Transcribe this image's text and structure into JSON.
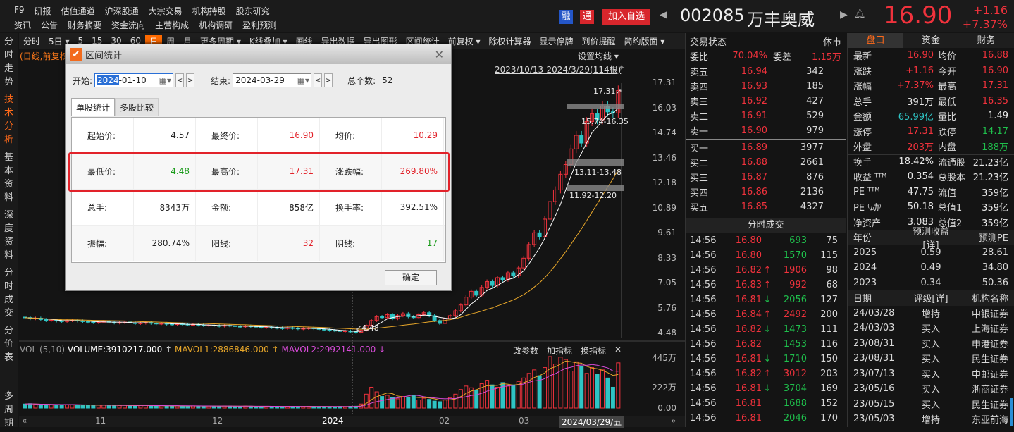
{
  "top_menu": {
    "row1": [
      "F9",
      "研报",
      "估值通道",
      "沪深股通",
      "大宗交易",
      "机构持股",
      "股东研究"
    ],
    "row2": [
      "资讯",
      "公告",
      "财务摘要",
      "资金流向",
      "主营构成",
      "机构调研",
      "盈利预测"
    ]
  },
  "header": {
    "badge_rong": "融",
    "badge_tong": "通",
    "add_watchlist": "加入自选",
    "code": "002085",
    "name": "万丰奥威",
    "price": "16.90",
    "change": "+1.16",
    "change_pct": "+7.37%"
  },
  "sidebar": [
    "分时走势",
    "技术分析",
    "基本资料",
    "深度资料",
    "分时成交",
    "分价表",
    "多周期"
  ],
  "toolbar": [
    "分时",
    "5日 ▾",
    "5",
    "15",
    "30",
    "60",
    "日",
    "周",
    "月",
    "更多周期 ▾",
    "K线叠加 ▾",
    "画线",
    "导出数据",
    "导出图形",
    "区间统计",
    "前复权 ▾",
    "除权计算器",
    "显示停牌",
    "到价提醒",
    "简约版面 ▾"
  ],
  "chart": {
    "mode_label": "(日线,前复权)",
    "ma_setting": "设置均线 ▾",
    "range_label": "2023/10/13-2024/3/29(114根)",
    "high_label": "17.31↗",
    "low_label": "↙4.48",
    "zone1": "15.74-16.35",
    "zone2": "13.11-13.48",
    "zone3": "11.92-12.20",
    "price_ticks": [
      "17.31",
      "16.03",
      "14.74",
      "13.46",
      "12.18",
      "10.89",
      "9.61",
      "8.33",
      "7.05",
      "5.76",
      "4.48"
    ],
    "vol_legend": {
      "vol": "VOL (5,10)",
      "volume": "VOLUME:3910217.000 ↑",
      "mavol1": "MAVOL1:2886846.000 ↑",
      "mavol2": "MAVOL2:2992141.000 ↓"
    },
    "vol_actions": [
      "改参数",
      "加指标",
      "换指标",
      "✕"
    ],
    "vol_ticks": [
      "445万",
      "222万",
      "0.00"
    ],
    "date_ticks": [
      "11",
      "12",
      "2024",
      "02",
      "03"
    ],
    "cursor_date": "2024/03/29/五"
  },
  "chart_data": {
    "type": "candlestick",
    "range": "2023/10/13-2024/3/29",
    "ylim": [
      4.48,
      17.31
    ],
    "closes": [
      5.25,
      5.2,
      5.22,
      5.15,
      5.1,
      5.12,
      5.08,
      5.05,
      5.1,
      5.12,
      5.08,
      5.05,
      5.02,
      5.0,
      5.03,
      5.05,
      5.02,
      4.98,
      5.0,
      5.02,
      4.98,
      4.95,
      4.97,
      5.0,
      4.96,
      4.94,
      4.95,
      4.92,
      4.9,
      4.93,
      4.91,
      4.88,
      4.9,
      4.87,
      4.85,
      4.86,
      4.84,
      4.82,
      4.85,
      4.83,
      4.8,
      4.78,
      4.82,
      4.8,
      4.78,
      4.75,
      4.77,
      4.74,
      4.72,
      4.7,
      4.73,
      4.71,
      4.68,
      4.7,
      4.72,
      4.69,
      4.65,
      4.62,
      4.6,
      4.58,
      4.55,
      4.57,
      4.52,
      4.5,
      4.6,
      4.85,
      5.1,
      5.3,
      5.25,
      5.4,
      5.2,
      5.35,
      5.45,
      5.3,
      5.25,
      5.4,
      5.5,
      5.35,
      5.1,
      4.95,
      5.2,
      5.35,
      5.6,
      5.9,
      6.3,
      6.6,
      6.4,
      6.8,
      7.1,
      6.9,
      7.3,
      7.2,
      7.55,
      7.4,
      7.8,
      8.3,
      9.0,
      9.6,
      9.4,
      10.3,
      11.2,
      11.8,
      12.6,
      13.1,
      13.9,
      14.6,
      14.2,
      15.3,
      15.7,
      15.4,
      16.1,
      15.8,
      15.74,
      16.9
    ],
    "volumes_wan": [
      35,
      38,
      32,
      30,
      28,
      30,
      27,
      25,
      28,
      30,
      26,
      25,
      24,
      24,
      25,
      26,
      22,
      20,
      22,
      24,
      21,
      20,
      22,
      23,
      20,
      19,
      20,
      18,
      19,
      20,
      18,
      17,
      19,
      18,
      17,
      17,
      16,
      16,
      18,
      17,
      15,
      15,
      17,
      16,
      15,
      14,
      15,
      14,
      13,
      13,
      15,
      14,
      13,
      14,
      15,
      14,
      13,
      13,
      12,
      12,
      14,
      13,
      15,
      16,
      35,
      120,
      180,
      140,
      100,
      110,
      90,
      80,
      100,
      95,
      110,
      70,
      85,
      75,
      60,
      55,
      70,
      90,
      120,
      160,
      190,
      175,
      150,
      210,
      240,
      200,
      180,
      220,
      190,
      200,
      230,
      260,
      300,
      330,
      280,
      350,
      445,
      380,
      440,
      420,
      320,
      400,
      360,
      300,
      350,
      290,
      330,
      260,
      180,
      391
    ],
    "vol_ylim": [
      0,
      445
    ]
  },
  "dialog": {
    "title": "区间统计",
    "start_label": "开始:",
    "start_sel": "2024",
    "start_rest": "-01-10",
    "end_label": "结束:",
    "end_value": "2024-03-29",
    "count_label": "总个数:",
    "count": "52",
    "tab1": "单股统计",
    "tab2": "多股比较",
    "ok": "确定",
    "rows": [
      [
        [
          "起始价:",
          "4.57"
        ],
        [
          "最终价:",
          "16.90"
        ],
        [
          "均价:",
          "10.29"
        ]
      ],
      [
        [
          "最低价:",
          "4.48"
        ],
        [
          "最高价:",
          "17.31"
        ],
        [
          "涨跌幅:",
          "269.80%"
        ]
      ],
      [
        [
          "总手:",
          "8343万"
        ],
        [
          "金额:",
          "858亿"
        ],
        [
          "换手率:",
          "392.51%"
        ]
      ],
      [
        [
          "振幅:",
          "280.74%"
        ],
        [
          "阳线:",
          "32"
        ],
        [
          "阴线:",
          "17"
        ]
      ]
    ]
  },
  "orderbook": {
    "status_label": "交易状态",
    "status": "休市",
    "wb_label": "委比",
    "wb": "70.04%",
    "wc_label": "委差",
    "wc": "1.15万",
    "asks": [
      [
        "卖五",
        "16.94",
        "342"
      ],
      [
        "卖四",
        "16.93",
        "185"
      ],
      [
        "卖三",
        "16.92",
        "427"
      ],
      [
        "卖二",
        "16.91",
        "529"
      ],
      [
        "卖一",
        "16.90",
        "979"
      ]
    ],
    "bids": [
      [
        "买一",
        "16.89",
        "3977"
      ],
      [
        "买二",
        "16.88",
        "2661"
      ],
      [
        "买三",
        "16.87",
        "876"
      ],
      [
        "买四",
        "16.86",
        "2136"
      ],
      [
        "买五",
        "16.85",
        "4327"
      ]
    ],
    "ticks_title": "分时成交",
    "ticks": [
      [
        "14:56",
        "16.80",
        "",
        "693",
        "75",
        "g"
      ],
      [
        "14:56",
        "16.80",
        "",
        "1570",
        "115",
        "g"
      ],
      [
        "14:56",
        "16.82",
        "↑",
        "1906",
        "98",
        "r"
      ],
      [
        "14:56",
        "16.83",
        "↑",
        "992",
        "68",
        "r"
      ],
      [
        "14:56",
        "16.81",
        "↓",
        "2056",
        "127",
        "g"
      ],
      [
        "14:56",
        "16.84",
        "↑",
        "2492",
        "200",
        "r"
      ],
      [
        "14:56",
        "16.82",
        "↓",
        "1473",
        "111",
        "g"
      ],
      [
        "14:56",
        "16.82",
        "",
        "1453",
        "116",
        "g"
      ],
      [
        "14:56",
        "16.81",
        "↓",
        "1710",
        "150",
        "g"
      ],
      [
        "14:56",
        "16.82",
        "↑",
        "3012",
        "203",
        "r"
      ],
      [
        "14:56",
        "16.81",
        "↓",
        "3704",
        "169",
        "g"
      ],
      [
        "14:56",
        "16.81",
        "",
        "1688",
        "152",
        "g"
      ],
      [
        "14:56",
        "16.81",
        "",
        "2046",
        "170",
        "g"
      ]
    ]
  },
  "quote": {
    "tabs": [
      "盘口",
      "资金",
      "财务"
    ],
    "rows": [
      [
        "最新",
        "16.90",
        "r",
        "均价",
        "16.88",
        "r"
      ],
      [
        "涨跌",
        "+1.16",
        "r",
        "今开",
        "16.90",
        "r"
      ],
      [
        "涨幅",
        "+7.37%",
        "r",
        "最高",
        "17.31",
        "r"
      ],
      [
        "总手",
        "391万",
        "w",
        "最低",
        "16.35",
        "r"
      ],
      [
        "金额",
        "65.99亿",
        "c",
        "量比",
        "1.49",
        "w"
      ],
      [
        "涨停",
        "17.31",
        "r",
        "跌停",
        "14.17",
        "g"
      ],
      [
        "外盘",
        "203万",
        "r",
        "内盘",
        "188万",
        "g"
      ],
      [
        "换手",
        "18.42%",
        "w",
        "流通股",
        "21.23亿",
        "w"
      ],
      [
        "收益 ᵀᵀᴹ",
        "0.354",
        "w",
        "总股本",
        "21.23亿",
        "w"
      ],
      [
        "PE ᵀᵀᴹ",
        "47.75",
        "w",
        "流值",
        "359亿",
        "w"
      ],
      [
        "PE ⁽动⁾",
        "50.18",
        "w",
        "总值1",
        "359亿",
        "w"
      ],
      [
        "净资产",
        "3.083",
        "w",
        "总值2",
        "359亿",
        "w"
      ]
    ],
    "forecast_head": [
      "年份",
      "预测收益[详]",
      "预测PE"
    ],
    "forecast": [
      [
        "2025",
        "0.59",
        "28.61"
      ],
      [
        "2024",
        "0.49",
        "34.80"
      ],
      [
        "2023",
        "0.34",
        "50.36"
      ]
    ],
    "rating_head": [
      "日期",
      "评级[详]",
      "机构名称"
    ],
    "ratings": [
      [
        "24/03/28",
        "增持",
        "中银证券"
      ],
      [
        "24/03/03",
        "买入",
        "上海证券"
      ],
      [
        "23/08/31",
        "买入",
        "申港证券"
      ],
      [
        "23/08/31",
        "买入",
        "民生证券"
      ],
      [
        "23/07/13",
        "买入",
        "中邮证券"
      ],
      [
        "23/05/16",
        "买入",
        "浙商证券"
      ],
      [
        "23/05/15",
        "买入",
        "民生证券"
      ],
      [
        "23/05/03",
        "增持",
        "东亚前海"
      ]
    ]
  }
}
